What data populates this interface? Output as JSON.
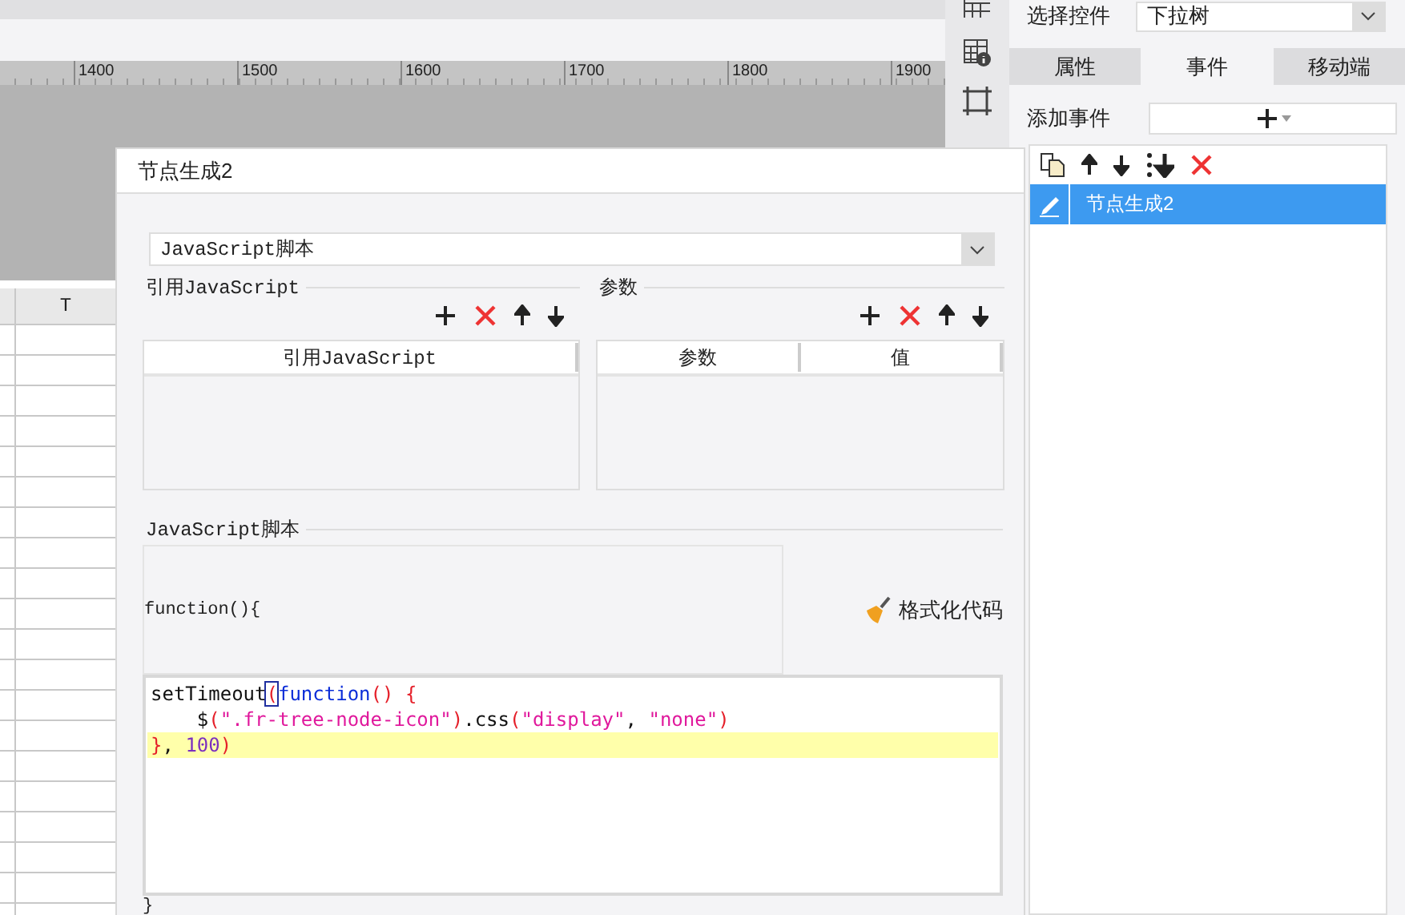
{
  "ruler": {
    "labels": [
      "1400",
      "1500",
      "1600",
      "1700",
      "1800",
      "1900"
    ]
  },
  "sheet": {
    "column_header": "T"
  },
  "property_panel": {
    "control_label": "选择控件",
    "control_value": "下拉树",
    "tabs": [
      {
        "label": "属性",
        "selected": false
      },
      {
        "label": "事件",
        "selected": true
      },
      {
        "label": "移动端",
        "selected": false
      }
    ],
    "add_event_label": "添加事件",
    "events": [
      {
        "label": "节点生成2",
        "selected": true
      }
    ]
  },
  "dialog": {
    "title": "节点生成2",
    "type_select": "JavaScript脚本",
    "imports": {
      "title": "引用JavaScript",
      "columns": [
        "引用JavaScript"
      ]
    },
    "params": {
      "title": "参数",
      "columns": [
        "参数",
        "值"
      ]
    },
    "script": {
      "title": "JavaScript脚本",
      "header": "function(){",
      "format_button": "格式化代码",
      "code_lines": [
        {
          "current": false,
          "tokens": [
            {
              "text": "setTimeout",
              "kind": "plain"
            },
            {
              "text": "(",
              "kind": "matched"
            },
            {
              "text": "function",
              "kind": "keyword"
            },
            {
              "text": "() {",
              "kind": "paren"
            }
          ]
        },
        {
          "current": false,
          "tokens": [
            {
              "text": "    $",
              "kind": "plain"
            },
            {
              "text": "(",
              "kind": "paren"
            },
            {
              "text": "\".fr-tree-node-icon\"",
              "kind": "string"
            },
            {
              "text": ")",
              "kind": "paren"
            },
            {
              "text": ".css",
              "kind": "plain"
            },
            {
              "text": "(",
              "kind": "paren"
            },
            {
              "text": "\"display\"",
              "kind": "string"
            },
            {
              "text": ", ",
              "kind": "plain"
            },
            {
              "text": "\"none\"",
              "kind": "string"
            },
            {
              "text": ")",
              "kind": "paren"
            }
          ]
        },
        {
          "current": true,
          "tokens": [
            {
              "text": "}",
              "kind": "paren"
            },
            {
              "text": ", ",
              "kind": "plain"
            },
            {
              "text": "100",
              "kind": "number"
            },
            {
              "text": ")",
              "kind": "paren"
            }
          ]
        }
      ],
      "footer": "}"
    }
  }
}
